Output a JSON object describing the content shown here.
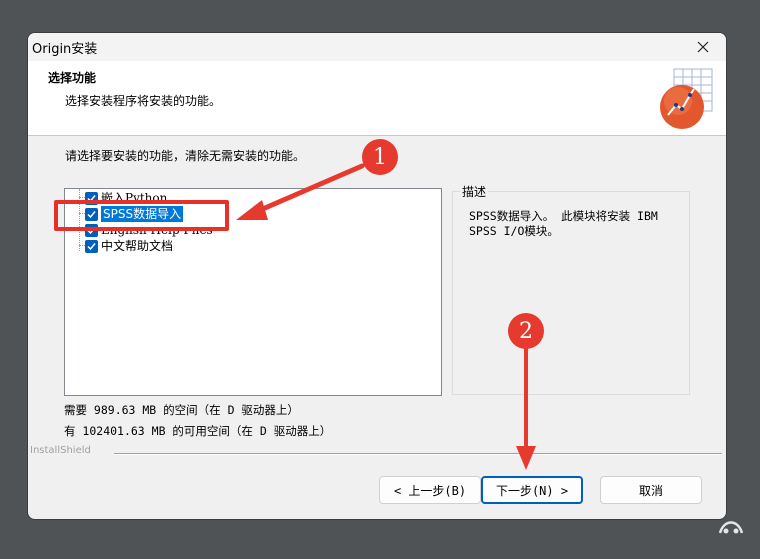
{
  "window": {
    "title": "Origin安装",
    "close_glyph": "✕"
  },
  "header": {
    "title": "选择功能",
    "subtitle": "选择安装程序将安装的功能。",
    "logo_icon": "origin-graph-icon"
  },
  "prompt": "请选择要安装的功能，清除无需安装的功能。",
  "features": [
    {
      "label": "嵌入Python",
      "checked": true,
      "selected": false
    },
    {
      "label": "SPSS数据导入",
      "checked": true,
      "selected": true
    },
    {
      "label": "English Help Files",
      "checked": true,
      "selected": false
    },
    {
      "label": "中文帮助文档",
      "checked": true,
      "selected": false
    }
  ],
  "description": {
    "caption": "描述",
    "text": "SPSS数据导入。 此模块将安装 IBM SPSS I/O模块。"
  },
  "space": {
    "required": "需要 989.63 MB 的空间（在 D 驱动器上）",
    "available": "有 102401.63 MB 的可用空间（在 D 驱动器上）"
  },
  "installshield": "InstallShield",
  "buttons": {
    "back": "< 上一步(B)",
    "next": "下一步(N) >",
    "cancel": "取消"
  },
  "annotations": {
    "badge1": "1",
    "badge2": "2",
    "color": "#e63a2e"
  }
}
